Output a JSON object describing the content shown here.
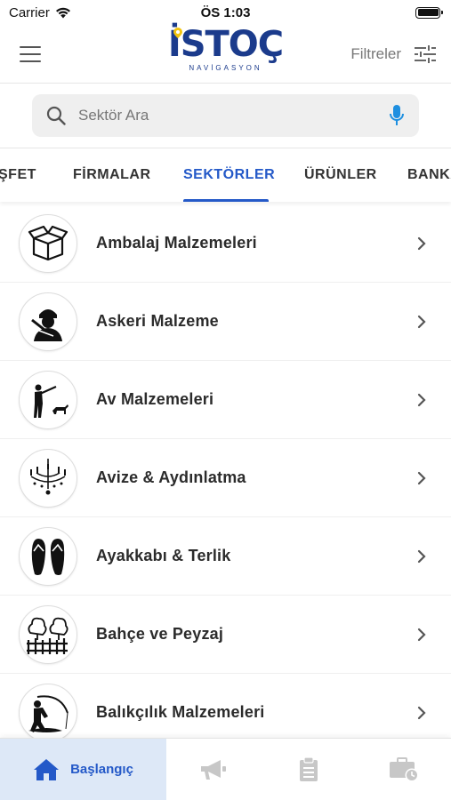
{
  "status_bar": {
    "carrier": "Carrier",
    "time": "ÖS 1:03"
  },
  "header": {
    "logo_text": "İSTOÇ",
    "logo_subtitle": "NAVİGASYON",
    "filters_label": "Filtreler"
  },
  "search": {
    "placeholder": "Sektör Ara",
    "value": ""
  },
  "tabs": [
    {
      "label": "ŞFET",
      "active": false
    },
    {
      "label": "FİRMALAR",
      "active": false
    },
    {
      "label": "SEKTÖRLER",
      "active": true
    },
    {
      "label": "ÜRÜNLER",
      "active": false
    },
    {
      "label": "BANKA",
      "active": false
    }
  ],
  "sectors": [
    {
      "label": "Ambalaj Malzemeleri",
      "icon": "box-icon"
    },
    {
      "label": "Askeri Malzeme",
      "icon": "soldier-icon"
    },
    {
      "label": "Av Malzemeleri",
      "icon": "hunter-icon"
    },
    {
      "label": "Avize & Aydınlatma",
      "icon": "chandelier-icon"
    },
    {
      "label": "Ayakkabı & Terlik",
      "icon": "flip-flops-icon"
    },
    {
      "label": "Bahçe ve Peyzaj",
      "icon": "garden-icon"
    },
    {
      "label": "Balıkçılık Malzemeleri",
      "icon": "fishing-icon"
    }
  ],
  "bottom_nav": [
    {
      "label": "Başlangıç",
      "icon": "home-icon",
      "active": true
    },
    {
      "label": "",
      "icon": "megaphone-icon",
      "active": false
    },
    {
      "label": "",
      "icon": "clipboard-icon",
      "active": false
    },
    {
      "label": "",
      "icon": "briefcase-clock-icon",
      "active": false
    }
  ],
  "colors": {
    "accent": "#2459c8",
    "active_nav_bg": "#dde8f7",
    "logo_blue": "#1b3b8c",
    "logo_yellow": "#f1c40f"
  }
}
